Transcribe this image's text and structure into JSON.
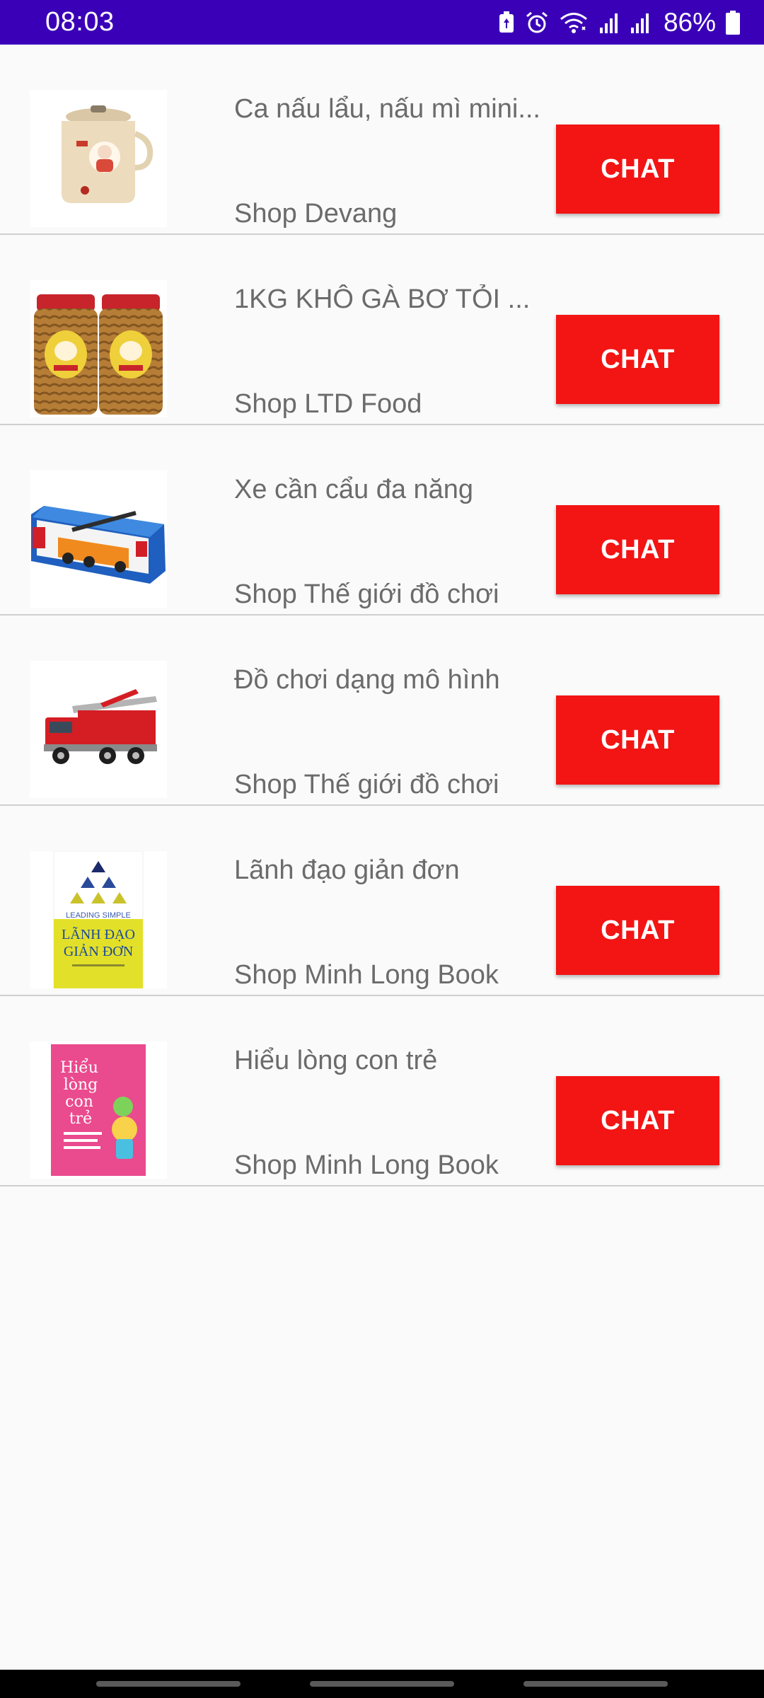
{
  "status_bar": {
    "time": "08:03",
    "battery_percent": "86%",
    "icons": [
      "battery-saver-icon",
      "alarm-icon",
      "wifi-icon",
      "signal-icon",
      "signal-icon",
      "battery-icon"
    ]
  },
  "products": [
    {
      "title": "Ca nấu lẩu, nấu mì mini...",
      "shop": "Shop Devang",
      "button": "CHAT",
      "thumbnail_icon": "kettle-pot-image"
    },
    {
      "title": "1KG KHÔ GÀ BƠ TỎI ...",
      "shop": "Shop LTD Food",
      "button": "CHAT",
      "thumbnail_icon": "snack-jars-image"
    },
    {
      "title": "Xe cần cẩu đa năng",
      "shop": "Shop Thế giới đồ chơi",
      "button": "CHAT",
      "thumbnail_icon": "crane-toy-box-image"
    },
    {
      "title": "Đồ chơi dạng mô hình",
      "shop": "Shop Thế giới đồ chơi",
      "button": "CHAT",
      "thumbnail_icon": "fire-truck-toy-image"
    },
    {
      "title": "Lãnh đạo giản đơn",
      "shop": "Shop Minh Long Book",
      "button": "CHAT",
      "thumbnail_icon": "book-cover-image",
      "cover_text": {
        "top": "LEADING SIMPLE",
        "main1": "LÃNH ĐẠO",
        "main2": "GIẢN ĐƠN"
      }
    },
    {
      "title": "Hiểu lòng con trẻ",
      "shop": "Shop Minh Long Book",
      "button": "CHAT",
      "thumbnail_icon": "book-cover-image",
      "cover_text": {
        "main1": "Hiểu",
        "main2": "lòng",
        "main3": "con",
        "main4": "trẻ"
      }
    }
  ],
  "colors": {
    "status_bar": "#3a00b8",
    "chat_button": "#f31414",
    "background": "#fafafa",
    "divider": "#cfcfcf",
    "text_secondary": "#6b6b6b"
  }
}
